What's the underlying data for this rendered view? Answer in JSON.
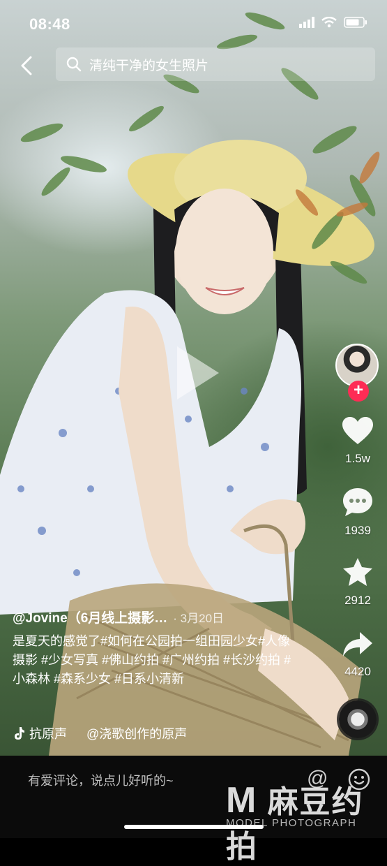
{
  "status_bar": {
    "time": "08:48"
  },
  "search": {
    "query": "清纯干净的女生照片"
  },
  "rail": {
    "likes": "1.5w",
    "comments": "1939",
    "favorites": "2912",
    "shares": "4420"
  },
  "caption": {
    "author": "@Jovine（6月线上摄影…",
    "date": "· 3月20日",
    "description": "是夏天的感觉了#如何在公园拍一组田园少女#人像摄影 #少女写真 #佛山约拍 #广州约拍 #长沙约拍 #小森林 #森系少女 #日系小清新"
  },
  "music": {
    "left": "抗原声",
    "right": "@浇歌创作的原声"
  },
  "bottom": {
    "comment_placeholder": "有爱评论，说点儿好听的~",
    "watermark_main": "麻豆约拍",
    "watermark_sub": "MODEL PHOTOGRAPH"
  },
  "colors": {
    "follow": "#fe2c55",
    "bar": "#0b0b0b"
  }
}
